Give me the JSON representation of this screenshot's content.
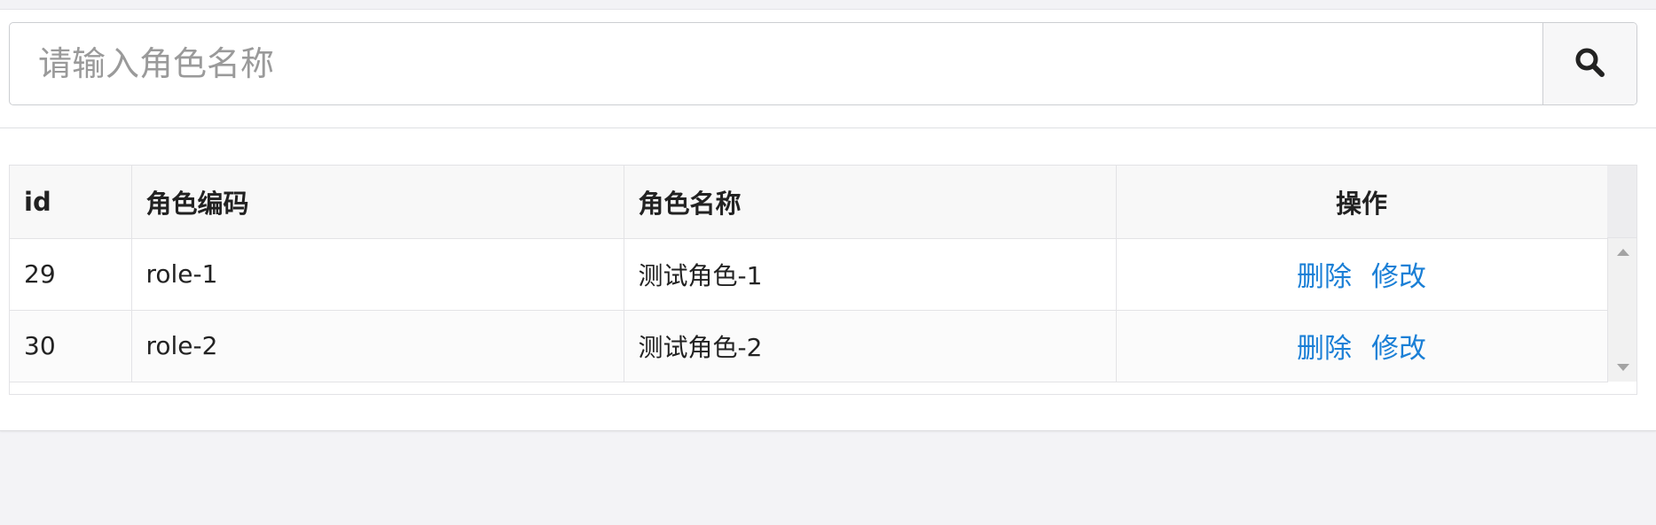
{
  "search": {
    "placeholder": "请输入角色名称",
    "value": "",
    "button_icon": "search-icon"
  },
  "table": {
    "columns": [
      "id",
      "角色编码",
      "角色名称",
      "操作"
    ],
    "rows": [
      {
        "id": "29",
        "code": "role-1",
        "name": "测试角色-1",
        "delete_label": "删除",
        "edit_label": "修改"
      },
      {
        "id": "30",
        "code": "role-2",
        "name": "测试角色-2",
        "delete_label": "删除",
        "edit_label": "修改"
      }
    ]
  },
  "colors": {
    "link": "#1a7fd6",
    "page_background": "#f3f3f6",
    "header_background": "#f8f8f8"
  }
}
